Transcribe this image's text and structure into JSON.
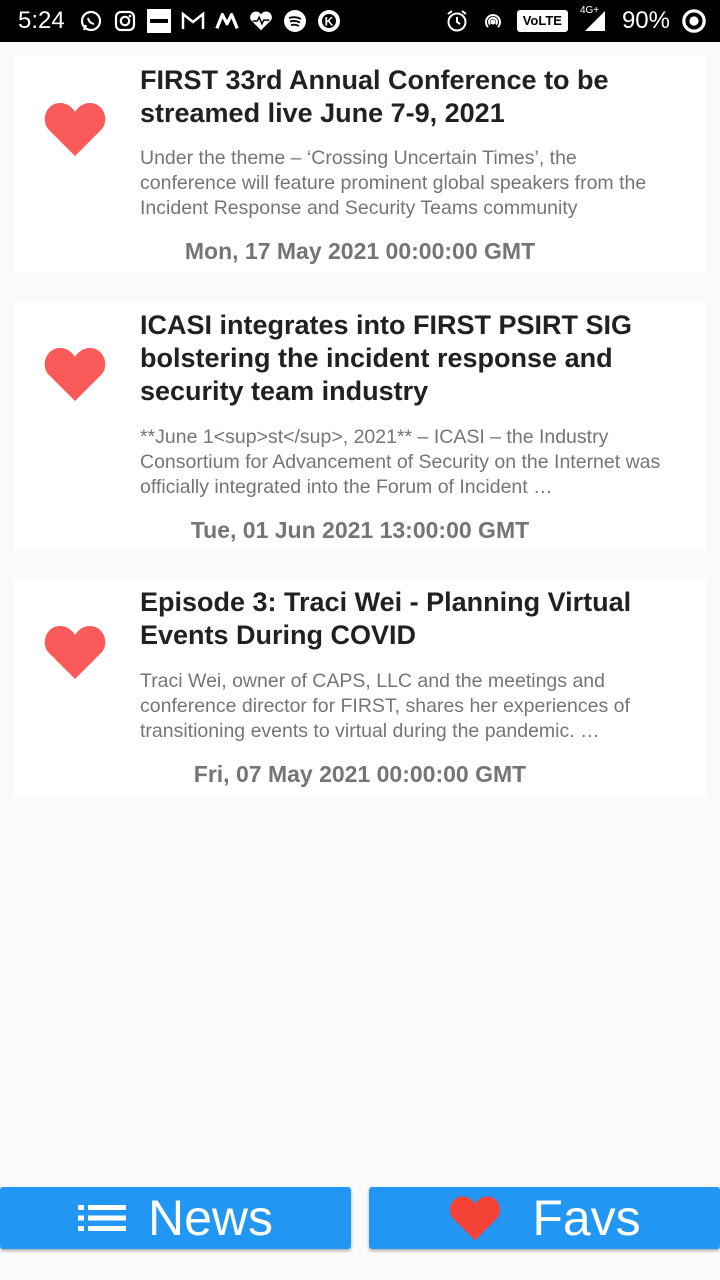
{
  "status_bar": {
    "time": "5:24",
    "volte": "VoLTE",
    "network": "4G+",
    "battery": "90%"
  },
  "articles": [
    {
      "title": "FIRST 33rd Annual Conference to be streamed live June 7-9, 2021",
      "description": "Under the theme – ‘Crossing Uncertain Times’, the conference will feature prominent global speakers from the Incident Response and Security Teams community",
      "date": "Mon, 17 May 2021 00:00:00 GMT",
      "favorited": true
    },
    {
      "title": "ICASI integrates into FIRST PSIRT SIG bolstering the incident response and security team industry",
      "description": "**June 1<sup>st</sup>, 2021** – ICASI – the Industry Consortium for Advancement of Security on the Internet was officially integrated into the Forum of Incident …",
      "date": "Tue, 01 Jun 2021 13:00:00 GMT",
      "favorited": true
    },
    {
      "title": "Episode 3: Traci Wei - Planning Virtual Events During COVID",
      "description": "Traci Wei, owner of CAPS, LLC and the meetings and conference director for FIRST, shares her experiences of transitioning events to virtual during the pandemic. …",
      "date": "Fri, 07 May 2021 00:00:00 GMT",
      "favorited": true
    }
  ],
  "nav": {
    "news_label": "News",
    "favs_label": "Favs",
    "news_icon": "list-icon",
    "favs_icon": "heart-icon"
  },
  "colors": {
    "heart": "#fa5a5a",
    "button": "#2196f3",
    "fav_heart": "#f44336"
  }
}
